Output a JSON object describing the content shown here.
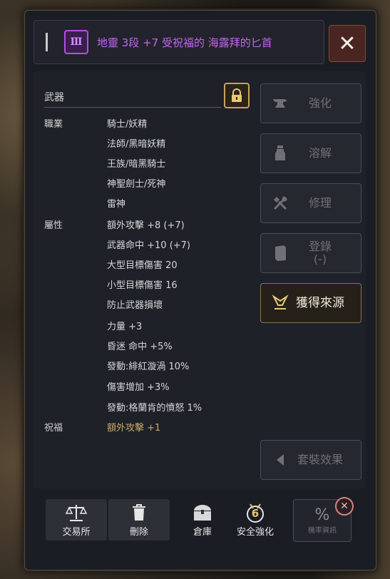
{
  "header": {
    "tier_roman": "Ⅲ",
    "title": "地靈 3段 +7 受祝福的 海露拜的匕首",
    "close_symbol": "✕"
  },
  "item": {
    "category": "武器",
    "class_label": "職業",
    "classes": [
      "騎士/妖精",
      "法師/黑暗妖精",
      "王族/暗黑騎士",
      "神聖劍士/死神",
      "雷神"
    ],
    "attr_label": "屬性",
    "attributes": [
      "額外攻擊 +8 (+7)",
      "武器命中 +10 (+7)",
      "大型目標傷害 20",
      "小型目標傷害 16",
      "防止武器損壞",
      "力量 +3",
      "昏迷 命中 +5%",
      "發動:緋紅漩渦 10%",
      "傷害增加 +3%",
      "發動:格蘭肯的憤怒 1%"
    ],
    "bless_label": "祝福",
    "bless_value": "額外攻擊 +1"
  },
  "side_buttons": {
    "enhance": "強化",
    "dissolve": "溶解",
    "repair": "修理",
    "register": "登錄",
    "register_sub": "(-)",
    "source": "獲得來源",
    "set_effect": "套裝效果"
  },
  "bottom": {
    "exchange": "交易所",
    "delete": "刪除",
    "storage": "倉庫",
    "safe_enhance": "安全強化",
    "safe_enhance_num": "6",
    "prob_symbol": "%",
    "prob_info": "機率資訊"
  },
  "colors": {
    "title": "#c466f0",
    "bless_value": "#c8a968",
    "accent_gold": "#e8c878"
  }
}
